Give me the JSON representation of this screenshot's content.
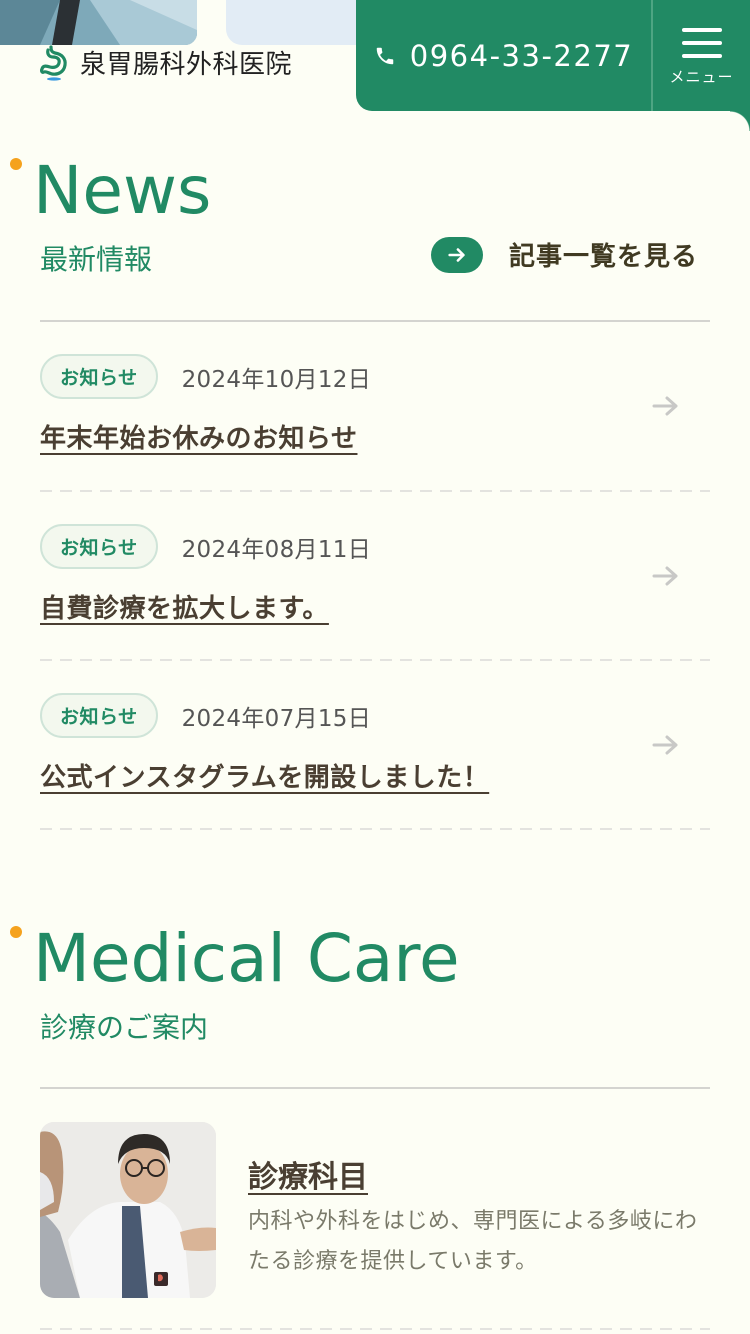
{
  "header": {
    "clinic_name": "泉胃腸科外科医院",
    "phone": "0964-33-2277",
    "menu_label": "メニュー"
  },
  "colors": {
    "brand_green": "#218a64",
    "accent_orange": "#f5a21d",
    "background": "#fdfef5",
    "text_dark": "#4a3f32"
  },
  "news": {
    "title_en": "News",
    "title_ja": "最新情報",
    "view_all_label": "記事一覧を見る",
    "items": [
      {
        "category": "お知らせ",
        "date": "2024年10月12日",
        "title": "年末年始お休みのお知らせ"
      },
      {
        "category": "お知らせ",
        "date": "2024年08月11日",
        "title": "自費診療を拡大します。"
      },
      {
        "category": "お知らせ",
        "date": "2024年07月15日",
        "title": "公式インスタグラムを開設しました！"
      }
    ]
  },
  "medical_care": {
    "title_en": "Medical Care",
    "title_ja": "診療のご案内",
    "cards": [
      {
        "title": "診療科目",
        "description": "内科や外科をはじめ、専門医による多岐にわたる診療を提供しています。"
      }
    ]
  }
}
